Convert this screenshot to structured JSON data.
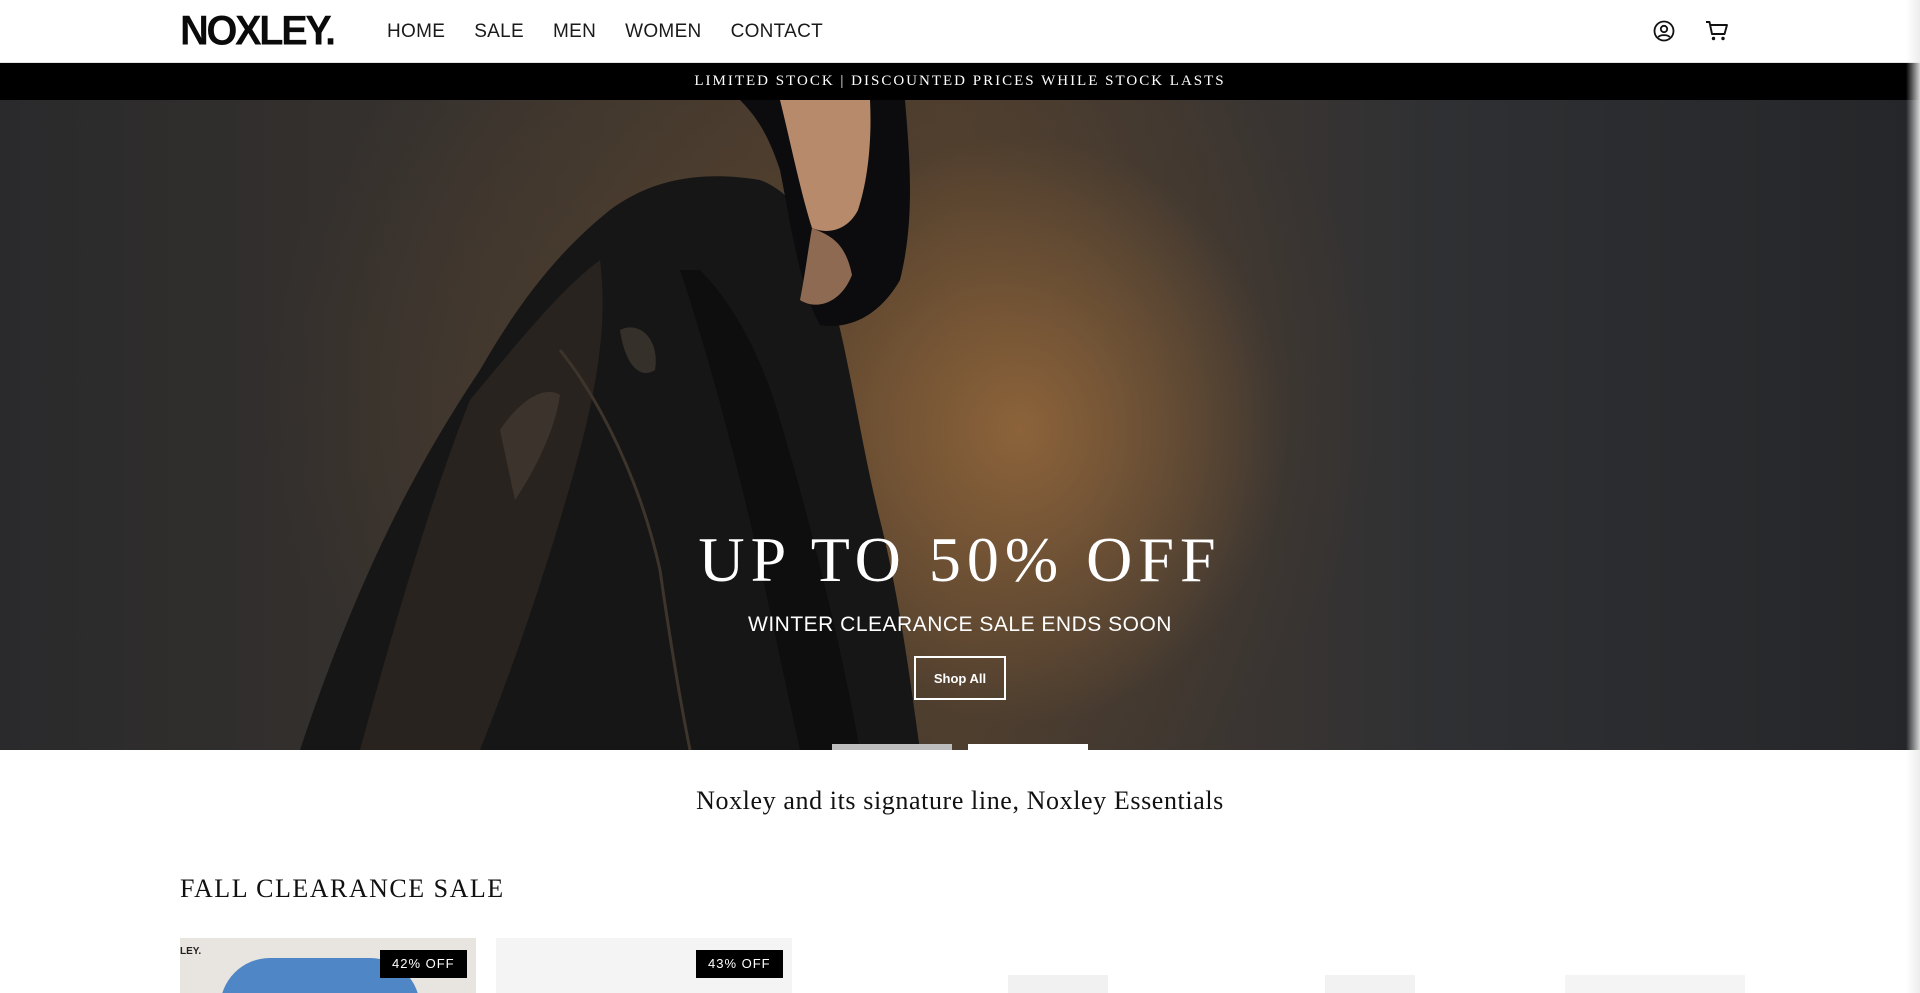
{
  "header": {
    "logo": "NOXLEY.",
    "nav": [
      "HOME",
      "SALE",
      "MEN",
      "WOMEN",
      "CONTACT"
    ],
    "icons": [
      "account-icon",
      "cart-icon"
    ]
  },
  "announcement": "LIMITED STOCK | DISCOUNTED PRICES WHILE STOCK LASTS",
  "hero": {
    "title": "UP TO 50% OFF",
    "subtitle": "WINTER CLEARANCE SALE ENDS SOON",
    "button": "Shop All",
    "slides": 2,
    "active_slide": 2
  },
  "tagline": "Noxley and its signature line, Noxley Essentials",
  "section": {
    "title": "FALL CLEARANCE SALE",
    "products": [
      {
        "badge": "42% OFF",
        "brand_mark": "LEY."
      },
      {
        "badge": "43% OFF"
      }
    ]
  },
  "colors": {
    "accent": "#000000",
    "background": "#ffffff",
    "text": "#111111"
  }
}
